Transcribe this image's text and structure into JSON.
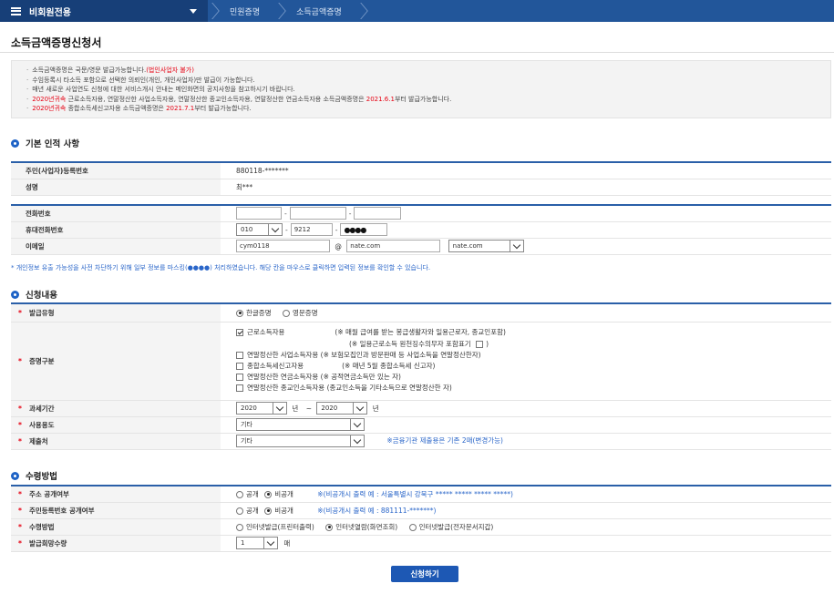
{
  "topbar": {
    "menu_label": "비회원전용",
    "crumbs": [
      "민원증명",
      "소득금액증명"
    ]
  },
  "page_title": "소득금액증명신청서",
  "notice": {
    "l1": "소득금액증명은 국문/영문 발급가능합니다.",
    "l1_red": "(법인사업자 불가)",
    "l2": "수임등록시 타소득 포함으로 선택한 의뢰인(개인, 개인사업자)만 발급이 가능합니다.",
    "l3": "매년 새로운 사업연도 신청에 대한 서비스개시 안내는 메인화면의 공지사항을 참고하시기 바랍니다.",
    "l4_red": "2020년귀속",
    "l4": " 근로소득자용, 연말정산한 사업소득자용, 연말정산한 종교인소득자용, 연말정산한 연금소득자용 소득금액증명은 ",
    "l4_red2": "2021.6.1",
    "l4_end": "부터 발급가능합니다.",
    "l5_red": "2020년귀속",
    "l5": " 종합소득세신고자용 소득금액증명은 ",
    "l5_red2": "2021.7.1",
    "l5_end": "부터 발급가능합니다."
  },
  "basic": {
    "heading": "기본 인적 사항",
    "reg_label": "주민(사업자)등록번호",
    "reg_value": "880118-*******",
    "name_label": "성명",
    "name_value": "최***",
    "phone_label": "전화번호",
    "mobile_label": "휴대전화번호",
    "mobile_prefix": "010",
    "mobile_mid": "9212",
    "mobile_last": "●●●●",
    "email_label": "이메일",
    "email_id": "cym0118",
    "email_at": "@",
    "email_domain": "nate.com",
    "email_select": "nate.com"
  },
  "privacy_note": "* 개인정보 유출 가능성을 사전 차단하기 위해 일부 정보를 마스킹(●●●●) 처리하였습니다. 해당 칸을 마우스로 클릭하면 입력된 정보를 확인할 수 있습니다.",
  "apply": {
    "heading": "신청내용",
    "issue_type_label": "발급유형",
    "issue_korean": "한글증명",
    "issue_english": "영문증명",
    "purpose_label": "증명구분",
    "p1": "근로소득자용",
    "p1_note": "(※ 매월 급여를 받는 봉급생활자와 일용근로자, 종교인포함)",
    "p1_note2": "(※ 일용근로소득 원천징수의무자 포함표기",
    "p1_note2_end": ")",
    "p2": "연말정산한 사업소득자용 (※ 보험모집인과 방문판매 등 사업소득을 연말정산한자)",
    "p3": "종합소득세신고자용",
    "p3_note": "(※ 매년 5월 종합소득세 신고자)",
    "p4": "연말정산한 연금소득자용 (※ 공적연금소득만 있는 자)",
    "p5": "연말정산한 종교인소득자용 (종교인소득을 기타소득으로 연말정산한 자)",
    "period_label": "과세기간",
    "year_from": "2020",
    "year_unit": "년",
    "tilde": "~",
    "year_to": "2020",
    "usage_label": "사용용도",
    "usage_value": "기타",
    "submit_to_label": "제출처",
    "submit_to_value": "기타",
    "submit_to_note": "※금융기관 제출용은 기존 2매(변경가능)"
  },
  "receive": {
    "heading": "수령방법",
    "addr_label": "주소 공개여부",
    "public": "공개",
    "private": "비공개",
    "addr_note": "※(비공개시 출력 예 : 서울특별시 강북구 ***** ***** ***** *****)",
    "rrn_label": "주민등록번호 공개여부",
    "rrn_note": "※(비공개시 출력 예 : 881111-*******)",
    "method_label": "수령방법",
    "m1": "인터넷발급(프린터출력)",
    "m2": "인터넷열람(화면조회)",
    "m3": "인터넷발급(전자문서지갑)",
    "copies_label": "발급희망수량",
    "copies_value": "1",
    "copies_unit": "매"
  },
  "submit_label": "신청하기"
}
